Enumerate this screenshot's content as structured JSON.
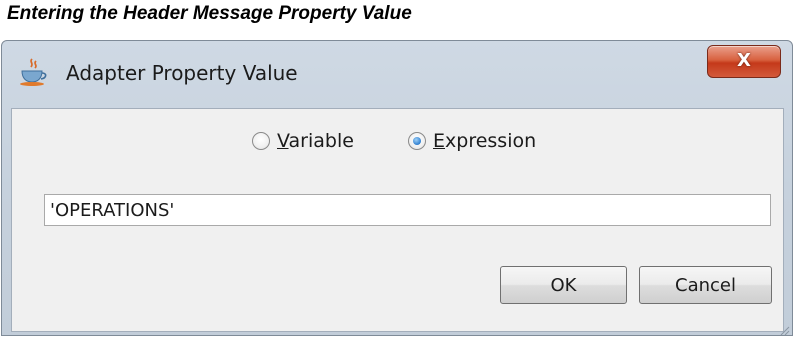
{
  "caption": "Entering the Header Message Property Value",
  "window": {
    "title": "Adapter Property Value",
    "close_label": "X"
  },
  "options": {
    "variable_mnemonic": "V",
    "variable_rest": "ariable",
    "expression_mnemonic": "E",
    "expression_rest": "xpression",
    "selected": "Expression"
  },
  "value_field": {
    "value": "'OPERATIONS'"
  },
  "buttons": {
    "ok": "OK",
    "cancel": "Cancel"
  },
  "icons": {
    "app": "java-cup-icon",
    "close": "close-icon",
    "resize": "resize-grip-icon"
  },
  "colors": {
    "close_button": "#c4391a",
    "radio_selected": "#2f7fd0"
  }
}
